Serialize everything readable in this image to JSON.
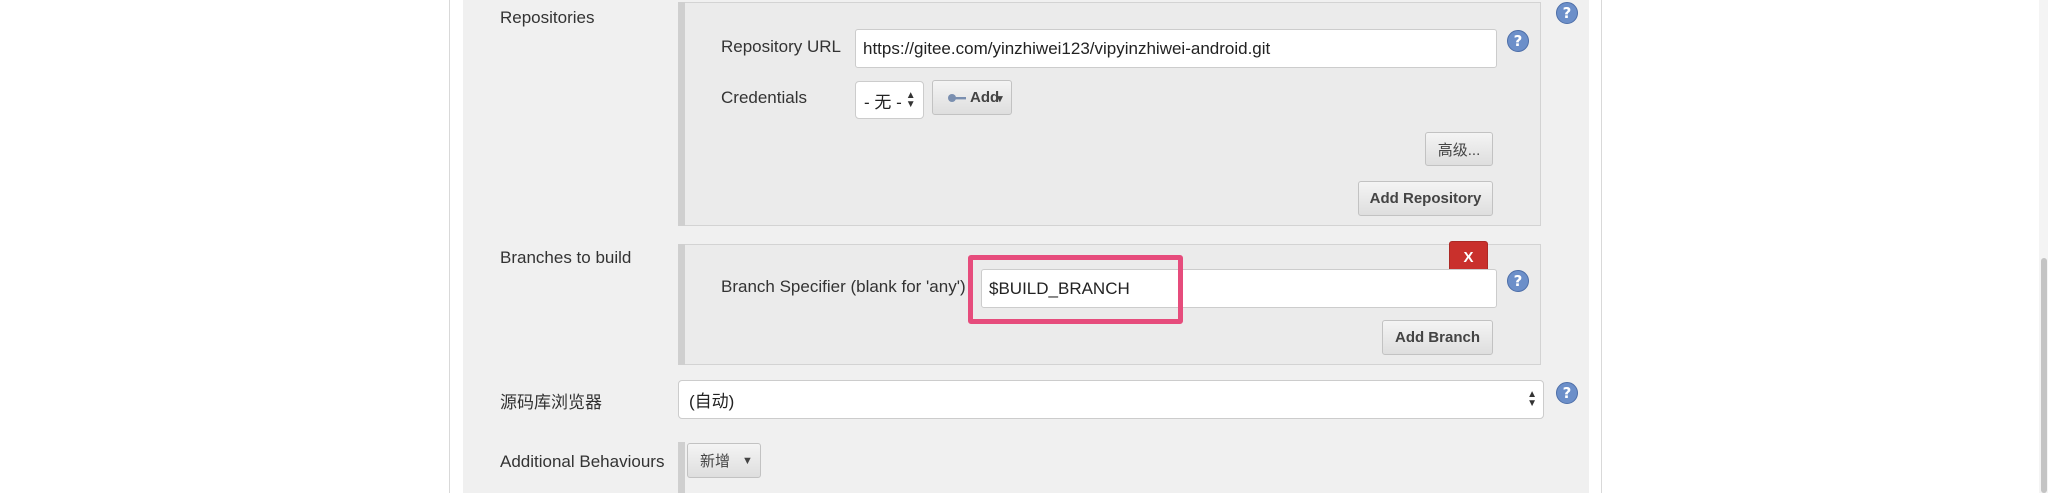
{
  "repositories": {
    "label": "Repositories",
    "url_label": "Repository URL",
    "url_value": "https://gitee.com/yinzhiwei123/vipyinzhiwei-android.git",
    "credentials_label": "Credentials",
    "credentials_selected": "- 无 -",
    "add_credentials_label": "Add",
    "advanced_label": "高级...",
    "add_repository_label": "Add Repository"
  },
  "branches": {
    "label": "Branches to build",
    "delete_label": "X",
    "specifier_label": "Branch Specifier (blank for 'any')",
    "specifier_value": "$BUILD_BRANCH",
    "add_branch_label": "Add Branch"
  },
  "repo_browser": {
    "label": "源码库浏览器",
    "selected": "(自动)"
  },
  "behaviours": {
    "label": "Additional Behaviours",
    "add_label": "新增"
  },
  "help_glyph": "?",
  "icons": {
    "help": "help-icon",
    "credentials_key": "key-icon",
    "select_arrows": "updown-arrows-icon",
    "dropdown": "caret-down-icon"
  },
  "colors": {
    "delete_button": "#c9302c",
    "highlight": "#e64c7c",
    "help_icon": "#6c8fc9"
  }
}
